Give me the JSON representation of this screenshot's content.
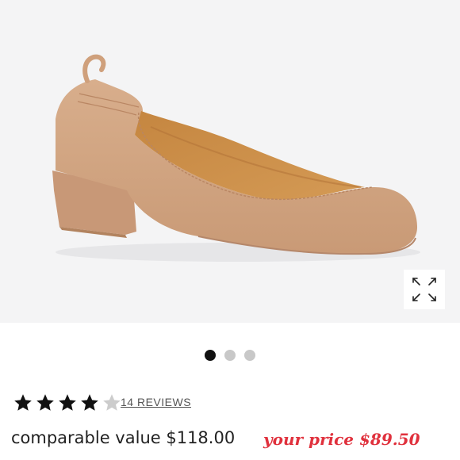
{
  "product": {
    "image_alt": "tan suede ballet pump with block heel",
    "reviews_label": "14 REVIEWS",
    "rating": 4,
    "rating_max": 5,
    "comparable_label": "comparable value $118.00",
    "your_price_label": "your price $89.50"
  },
  "carousel": {
    "slide_count": 3,
    "active_index": 0
  },
  "icons": {
    "expand": "expand-icon",
    "star_filled": "star-filled-icon",
    "star_empty": "star-empty-icon"
  },
  "colors": {
    "hero_bg": "#f4f4f5",
    "price_red": "#e0313d",
    "star_filled": "#111111",
    "star_empty": "#cccccc"
  }
}
